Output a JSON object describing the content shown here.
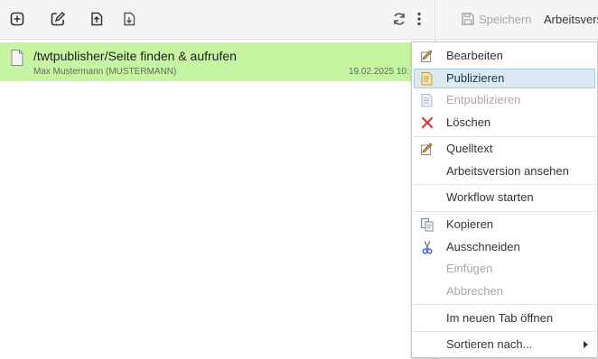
{
  "toolbar": {
    "icons": [
      "add-icon",
      "edit-icon",
      "upload-icon",
      "download-icon",
      "refresh-icon",
      "more-vertical-icon"
    ]
  },
  "right_toolbar": {
    "save_label": "Speichern",
    "arbeitsversion_label": "Arbeitsvers"
  },
  "list": {
    "row": {
      "title": "/twtpublisher/Seite finden & aufrufen",
      "author": "Max Mustermann (MUSTERMANN)",
      "date": "19.02.2025 10:"
    }
  },
  "context_menu": {
    "items": [
      {
        "label": "Bearbeiten",
        "icon": "edit-pencil-icon",
        "state": "enabled"
      },
      {
        "label": "Publizieren",
        "icon": "publish-icon",
        "state": "hover"
      },
      {
        "label": "Entpublizieren",
        "icon": "unpublish-icon",
        "state": "disabled"
      },
      {
        "label": "Löschen",
        "icon": "delete-x-icon",
        "state": "enabled"
      },
      {
        "label": "Quelltext",
        "icon": "source-edit-icon",
        "state": "enabled"
      },
      {
        "label": "Arbeitsversion ansehen",
        "icon": "",
        "state": "enabled"
      },
      {
        "label": "Workflow starten",
        "icon": "",
        "state": "enabled"
      },
      {
        "label": "Kopieren",
        "icon": "copy-icon",
        "state": "enabled"
      },
      {
        "label": "Ausschneiden",
        "icon": "scissors-icon",
        "state": "enabled"
      },
      {
        "label": "Einfügen",
        "icon": "",
        "state": "disabled"
      },
      {
        "label": "Abbrechen",
        "icon": "",
        "state": "disabled"
      },
      {
        "label": "Im neuen Tab öffnen",
        "icon": "",
        "state": "enabled"
      },
      {
        "label": "Sortieren nach...",
        "icon": "chevron-right-icon",
        "state": "enabled"
      }
    ]
  },
  "colors": {
    "selected_row": "#c5f5a0",
    "menu_hover": "#dbe9f2",
    "disabled_text": "#a9a9a9"
  }
}
